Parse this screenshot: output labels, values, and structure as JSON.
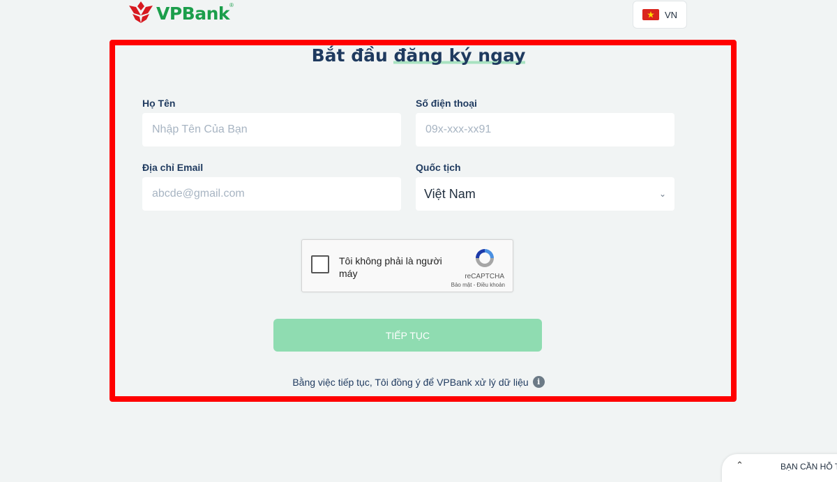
{
  "header": {
    "brand": "VPBank",
    "brand_mark": "®",
    "language": {
      "code": "VN",
      "flag": "vietnam-flag"
    }
  },
  "form": {
    "title_part1": "Bắt đầu ",
    "title_part2": "đăng ký ngay",
    "name": {
      "label": "Họ Tên",
      "placeholder": "Nhập Tên Của Bạn"
    },
    "phone": {
      "label": "Số điện thoại",
      "placeholder": "09x-xxx-xx91"
    },
    "email": {
      "label": "Địa chỉ Email",
      "placeholder": "abcde@gmail.com"
    },
    "nationality": {
      "label": "Quốc tịch",
      "value": "Việt Nam"
    },
    "captcha": {
      "text": "Tôi không phải là người máy",
      "brand": "reCAPTCHA",
      "links": "Bảo mật - Điều khoản"
    },
    "submit_label": "TIẾP TỤC",
    "consent_text": "Bằng việc tiếp tục, Tôi đồng ý để VPBank xử lý dữ liệu"
  },
  "support": {
    "label": "BẠN CẦN HỖ T"
  },
  "colors": {
    "accent": "#1b9e4b",
    "button": "#8fdcb1",
    "highlight_frame": "#ff0000",
    "title": "#1f3a5f"
  }
}
